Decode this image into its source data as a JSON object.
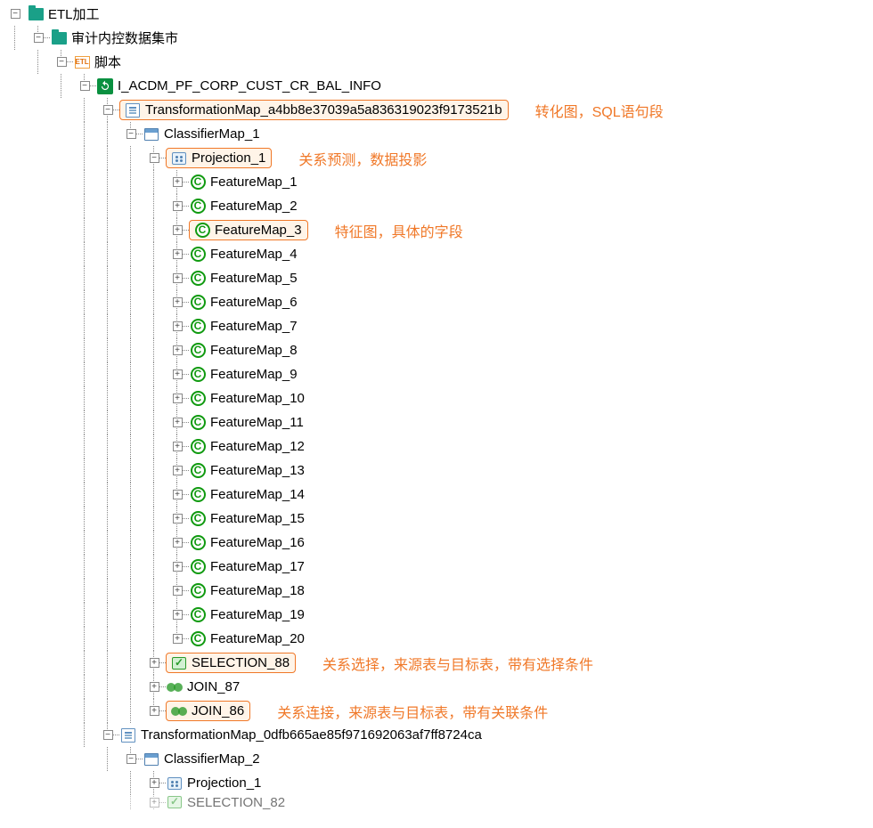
{
  "toggles": {
    "minus": "−",
    "plus": "+"
  },
  "tree": {
    "root": {
      "label": "ETL加工"
    },
    "datamart": {
      "label": "审计内控数据集市"
    },
    "scripts": {
      "label": "脚本",
      "etl_tag": "ETL"
    },
    "job": {
      "label": "I_ACDM_PF_CORP_CUST_CR_BAL_INFO"
    },
    "transform1": {
      "label": "TransformationMap_a4bb8e37039a5a836319023f9173521b",
      "annotation": "转化图，SQL语句段"
    },
    "classifier1": {
      "label": "ClassifierMap_1"
    },
    "projection1": {
      "label": "Projection_1",
      "annotation": "关系预测，数据投影"
    },
    "featuremaps": [
      "FeatureMap_1",
      "FeatureMap_2",
      "FeatureMap_3",
      "FeatureMap_4",
      "FeatureMap_5",
      "FeatureMap_6",
      "FeatureMap_7",
      "FeatureMap_8",
      "FeatureMap_9",
      "FeatureMap_10",
      "FeatureMap_11",
      "FeatureMap_12",
      "FeatureMap_13",
      "FeatureMap_14",
      "FeatureMap_15",
      "FeatureMap_16",
      "FeatureMap_17",
      "FeatureMap_18",
      "FeatureMap_19",
      "FeatureMap_20"
    ],
    "featuremap_highlight_index": 2,
    "featuremap_annotation": "特征图，具体的字段",
    "selection88": {
      "label": "SELECTION_88",
      "annotation": "关系选择，来源表与目标表，带有选择条件"
    },
    "join87": {
      "label": "JOIN_87"
    },
    "join86": {
      "label": "JOIN_86",
      "annotation": "关系连接，来源表与目标表，带有关联条件"
    },
    "transform2": {
      "label": "TransformationMap_0dfb665ae85f971692063af7ff8724ca"
    },
    "classifier2": {
      "label": "ClassifierMap_2"
    },
    "projection2": {
      "label": "Projection_1"
    },
    "selection82": {
      "label": "SELECTION_82"
    }
  }
}
